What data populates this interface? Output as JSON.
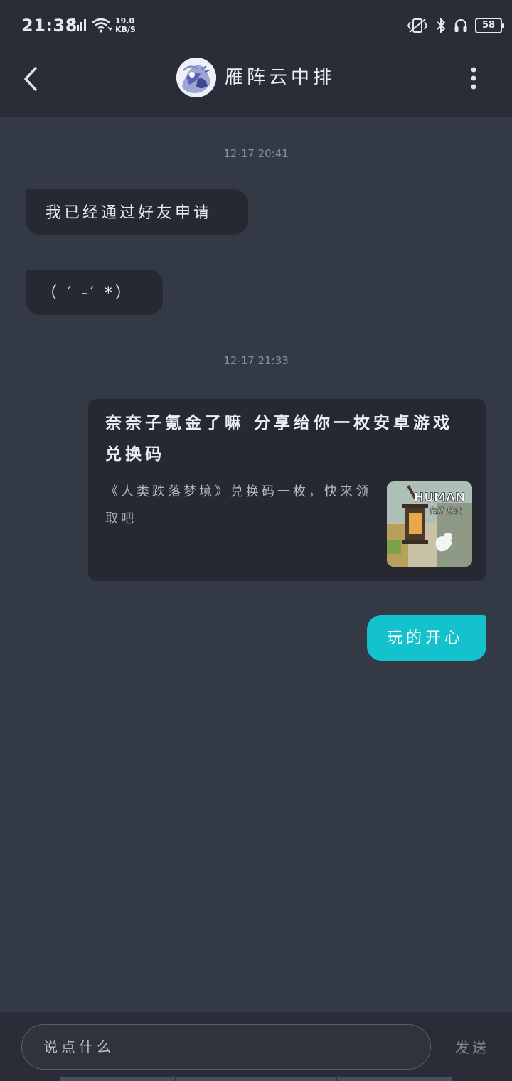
{
  "status_bar": {
    "time": "21:38",
    "network_type": "E",
    "speed_value": "19.0",
    "speed_unit": "KB/S",
    "battery": "58"
  },
  "header": {
    "contact_name": "雁阵云中排"
  },
  "messages": [
    {
      "type": "timestamp",
      "text": "12-17 20:41"
    },
    {
      "type": "incoming",
      "text": "我已经通过好友申请"
    },
    {
      "type": "incoming",
      "text": "（ ′ -′ *）"
    },
    {
      "type": "timestamp",
      "text": "12-17 21:33"
    },
    {
      "type": "share_card",
      "title": "奈奈子氪金了嘛 分享给你一枚安卓游戏兑换码",
      "description": "《人类跌落梦境》兑换码一枚，快来领取吧",
      "thumb_text_1": "HUMAN",
      "thumb_text_2": "fall flat"
    },
    {
      "type": "outgoing",
      "text": "玩的开心"
    }
  ],
  "input_bar": {
    "placeholder": "说点什么",
    "send_label": "发送"
  },
  "colors": {
    "background": "#343946",
    "bar": "#2a2d37",
    "bubble_in": "#262932",
    "bubble_out": "#13c2cc"
  }
}
